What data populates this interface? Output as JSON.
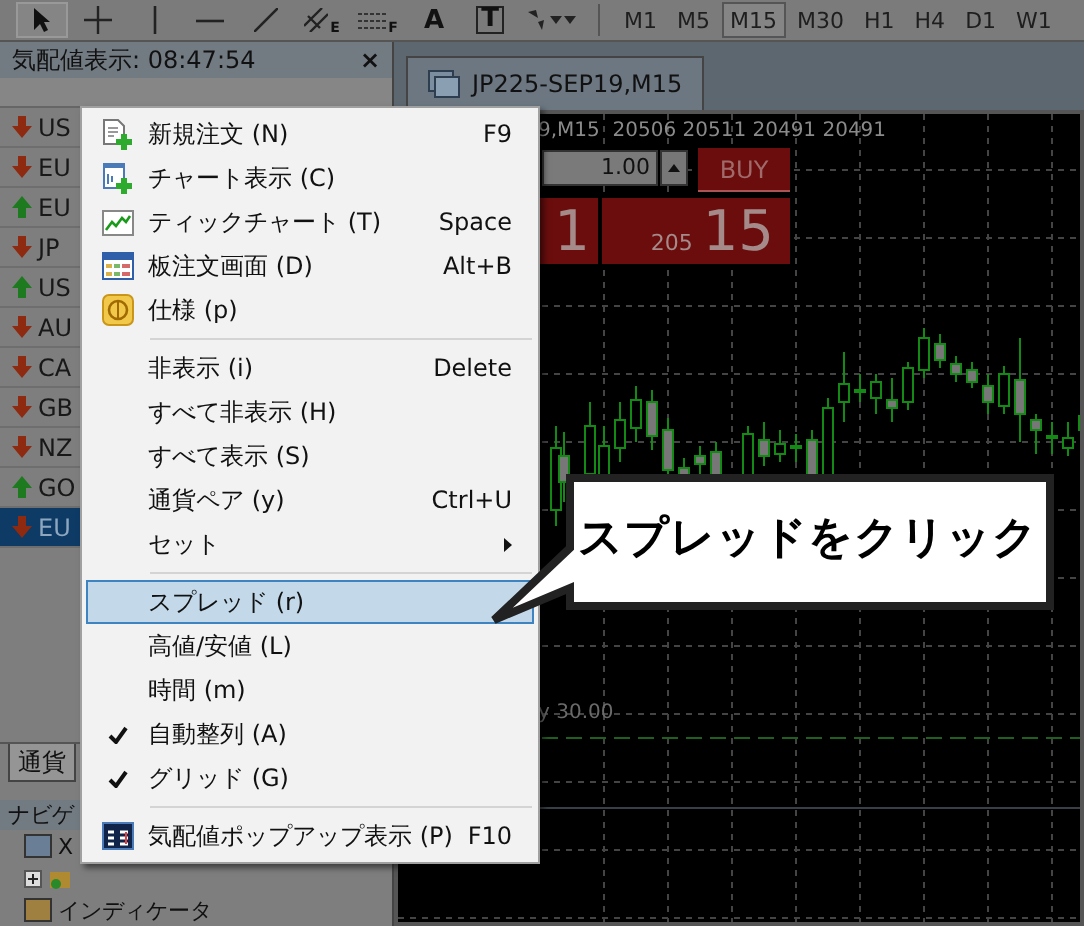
{
  "toolbar": {
    "tools": [
      {
        "kind": "cursor",
        "selected": true
      },
      {
        "kind": "crosshair",
        "selected": false
      },
      {
        "kind": "vline",
        "selected": false
      },
      {
        "kind": "hline",
        "selected": false
      },
      {
        "kind": "trendline",
        "selected": false
      },
      {
        "kind": "channel",
        "label": "E",
        "selected": false
      },
      {
        "kind": "fibo",
        "label": "F",
        "selected": false
      },
      {
        "kind": "text",
        "label": "A",
        "selected": false
      },
      {
        "kind": "textbox",
        "label": "T",
        "selected": false
      },
      {
        "kind": "shapes",
        "selected": false
      }
    ],
    "timeframes": [
      {
        "label": "M1",
        "selected": false
      },
      {
        "label": "M5",
        "selected": false
      },
      {
        "label": "M15",
        "selected": true
      },
      {
        "label": "M30",
        "selected": false
      },
      {
        "label": "H1",
        "selected": false
      },
      {
        "label": "H4",
        "selected": false
      },
      {
        "label": "D1",
        "selected": false
      },
      {
        "label": "W1",
        "selected": false
      }
    ]
  },
  "market_watch": {
    "title": "気配値表示: 08:47:54",
    "close": "×",
    "rows": [
      {
        "symbol": "US",
        "up": false,
        "selected": false
      },
      {
        "symbol": "EU",
        "up": false,
        "selected": false
      },
      {
        "symbol": "EU",
        "up": true,
        "selected": false
      },
      {
        "symbol": "JP",
        "up": false,
        "selected": false
      },
      {
        "symbol": "US",
        "up": true,
        "selected": false
      },
      {
        "symbol": "AU",
        "up": false,
        "selected": false
      },
      {
        "symbol": "CA",
        "up": false,
        "selected": false
      },
      {
        "symbol": "GB",
        "up": false,
        "selected": false
      },
      {
        "symbol": "NZ",
        "up": false,
        "selected": false
      },
      {
        "symbol": "GO",
        "up": true,
        "selected": false
      },
      {
        "symbol": "EU",
        "up": false,
        "selected": true
      }
    ],
    "tabs": [
      {
        "label": "通貨",
        "selected": true
      }
    ]
  },
  "navigator": {
    "title": "ナビゲ",
    "items": [
      {
        "kind": "window",
        "label": "X"
      },
      {
        "kind": "folder"
      },
      {
        "kind": "function",
        "label": "インディケータ"
      }
    ]
  },
  "chart": {
    "tab": "JP225-SEP19,M15",
    "info": "9,M15  20506 20511 20491 20491",
    "lot": "1.00",
    "buy_label": "BUY",
    "sell_tail": "1",
    "price_small": "205",
    "price_big": "15",
    "level_label": "y 30.00"
  },
  "menu": {
    "groups": [
      [
        {
          "kind": "icon",
          "label": "新規注文 (N)",
          "shortcut": "F9",
          "checked": false,
          "selected": false
        },
        {
          "kind": "icon",
          "label": "チャート表示 (C)",
          "checked": false,
          "selected": false
        },
        {
          "kind": "icon",
          "label": "ティックチャート (T)",
          "shortcut": "Space",
          "checked": false,
          "selected": false
        },
        {
          "kind": "icon",
          "label": "板注文画面 (D)",
          "shortcut": "Alt+B",
          "checked": false,
          "selected": false
        },
        {
          "kind": "icon",
          "label": "仕様 (p)",
          "checked": false,
          "selected": false
        }
      ],
      [
        {
          "kind": "plain",
          "label": "非表示 (i)",
          "shortcut": "Delete",
          "checked": false,
          "selected": false
        },
        {
          "kind": "plain",
          "label": "すべて非表示 (H)",
          "checked": false,
          "selected": false
        },
        {
          "kind": "plain",
          "label": "すべて表示 (S)",
          "checked": false,
          "selected": false
        },
        {
          "kind": "plain",
          "label": "通貨ペア (y)",
          "shortcut": "Ctrl+U",
          "checked": false,
          "selected": false
        },
        {
          "kind": "submenu",
          "label": "セット",
          "checked": false,
          "selected": false
        }
      ],
      [
        {
          "kind": "plain",
          "label": "スプレッド (r)",
          "checked": false,
          "selected": true
        },
        {
          "kind": "plain",
          "label": "高値/安値 (L)",
          "checked": false,
          "selected": false
        },
        {
          "kind": "plain",
          "label": "時間 (m)",
          "checked": false,
          "selected": false
        },
        {
          "kind": "plain",
          "label": "自動整列 (A)",
          "checked": true,
          "selected": false
        },
        {
          "kind": "plain",
          "label": "グリッド (G)",
          "checked": true,
          "selected": false
        }
      ],
      [
        {
          "kind": "icon",
          "label": "気配値ポップアップ表示 (P)",
          "shortcut": "F10",
          "checked": false,
          "selected": false
        }
      ]
    ]
  },
  "callout": {
    "text": "スプレッドをクリック"
  }
}
